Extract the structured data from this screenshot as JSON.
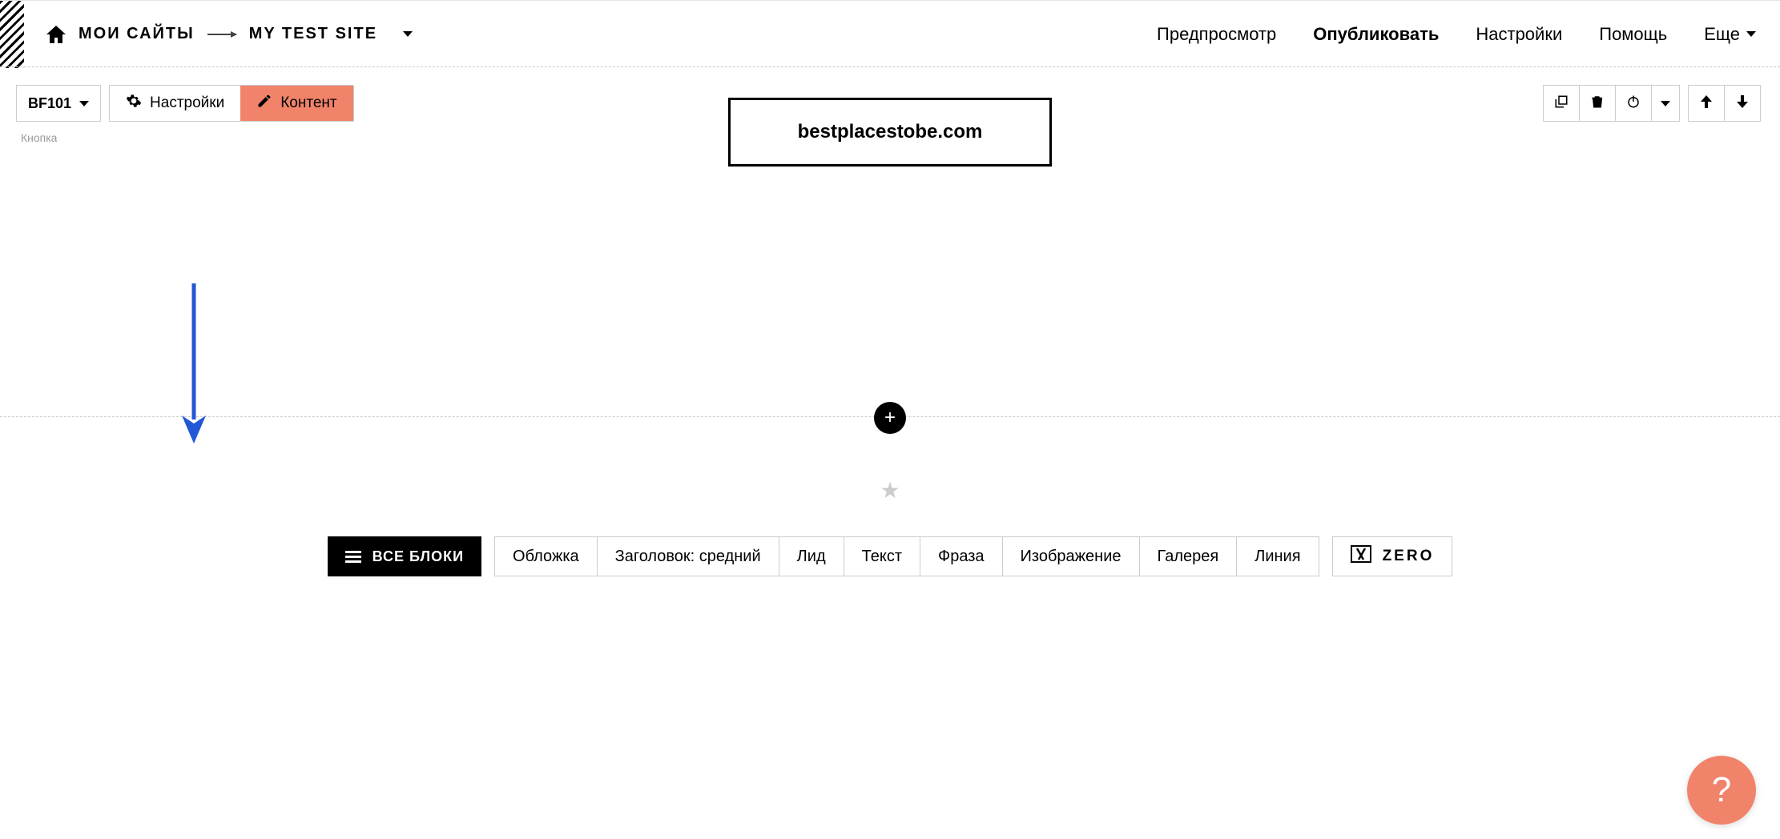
{
  "breadcrumb": {
    "root": "МОИ САЙТЫ",
    "site": "MY TEST SITE"
  },
  "topnav": {
    "preview": "Предпросмотр",
    "publish": "Опубликовать",
    "settings": "Настройки",
    "help": "Помощь",
    "more": "Еще"
  },
  "block_select": {
    "code": "BF101"
  },
  "tabs": {
    "settings": "Настройки",
    "content": "Контент"
  },
  "sub_label": "Кнопка",
  "canvas": {
    "button_text": "bestplacestobe.com"
  },
  "bottom": {
    "all_blocks": "ВСЕ БЛОКИ",
    "categories": [
      "Обложка",
      "Заголовок: средний",
      "Лид",
      "Текст",
      "Фраза",
      "Изображение",
      "Галерея",
      "Линия"
    ],
    "zero": "ZERO"
  },
  "help_fab": "?"
}
